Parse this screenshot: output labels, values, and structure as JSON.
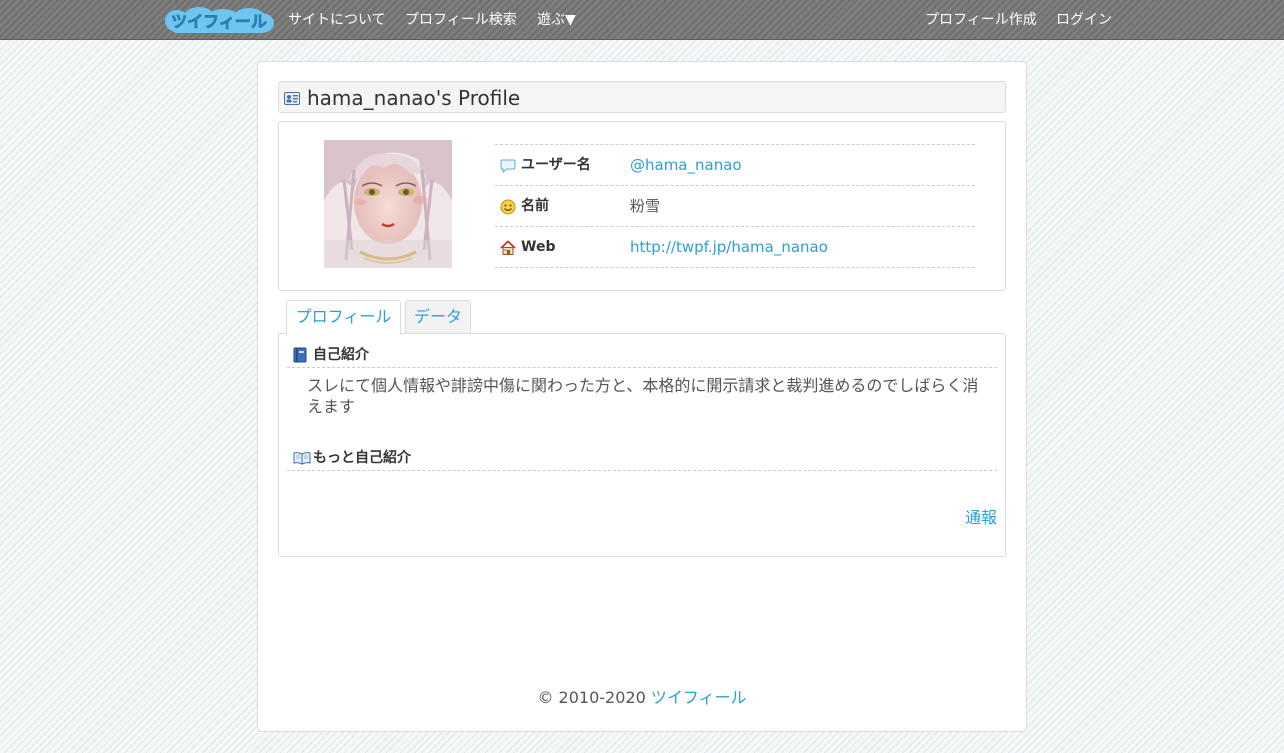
{
  "nav": {
    "logo_text": "ツイフィール",
    "links_left": [
      "サイトについて",
      "プロフィール検索",
      "遊ぶ▼"
    ],
    "links_right": [
      "プロフィール作成",
      "ログイン"
    ]
  },
  "profile": {
    "title": "hama_nanao's Profile",
    "rows": [
      {
        "icon": "speech-bubble-icon",
        "label": "ユーザー名",
        "value": "@hama_nanao"
      },
      {
        "icon": "smiley-icon",
        "label": "名前",
        "value": "粉雪"
      },
      {
        "icon": "house-icon",
        "label": "Web",
        "value": "http://twpf.jp/hama_nanao"
      }
    ]
  },
  "tabs": [
    "プロフィール",
    "データ"
  ],
  "sections": {
    "intro_heading": "自己紹介",
    "intro_text": "スレにて個人情報や誹謗中傷に関わった方と、本格的に開示請求と裁判進めるのでしばらく消えます",
    "more_heading": "もっと自己紹介"
  },
  "report_label": "通報",
  "footer": {
    "copyright": "© 2010-2020",
    "site_link": "ツイフィール"
  },
  "colors": {
    "link": "#2b9fd6",
    "navbar": "#787878"
  }
}
